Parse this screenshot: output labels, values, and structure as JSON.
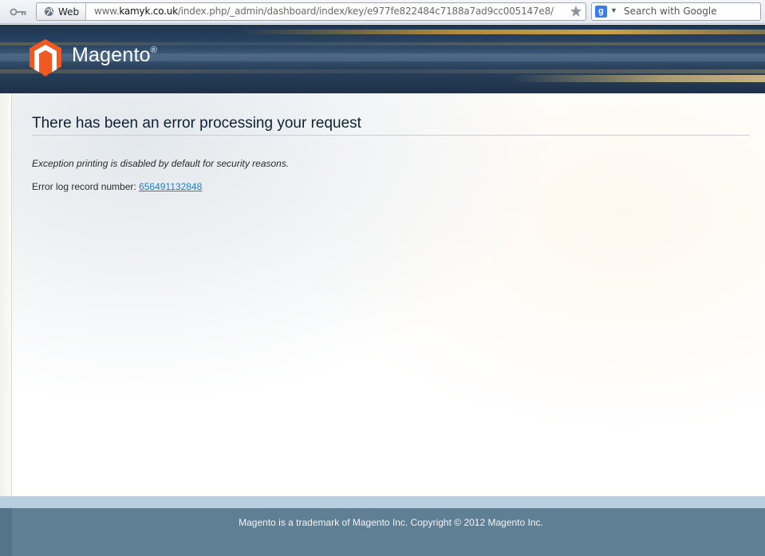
{
  "browser": {
    "web_button_label": "Web",
    "url_prefix": "www.",
    "url_host": "kamyk.co.uk",
    "url_path": "/index.php/_admin/dashboard/index/key/e977fe822484c7188a7ad9cc005147e8/",
    "search_placeholder": "Search with Google"
  },
  "header": {
    "brand_name": "Magento",
    "brand_mark": "®"
  },
  "main": {
    "title": "There has been an error processing your request",
    "exception_message": "Exception printing is disabled by default for security reasons.",
    "error_log_label": "Error log record number: ",
    "error_log_number": "656491132848"
  },
  "footer": {
    "copyright": "Magento is a trademark of Magento Inc. Copyright © 2012 Magento Inc."
  },
  "colors": {
    "header_bg": "#24405d",
    "logo_orange": "#ef5a22",
    "link": "#1e7ec8",
    "footer_bg": "#5f7f95",
    "footer_strip": "#b8cfe0"
  }
}
